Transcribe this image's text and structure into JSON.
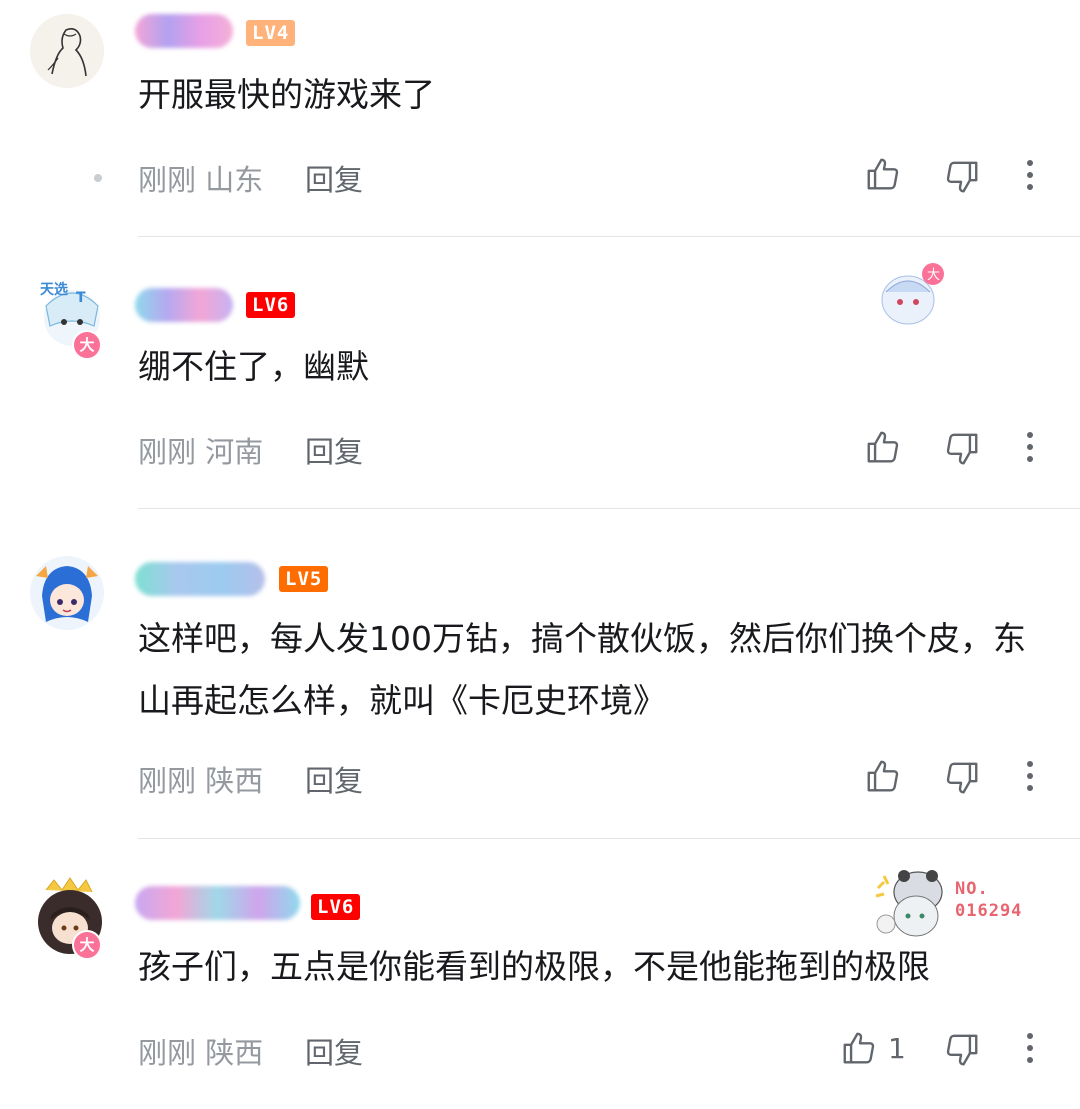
{
  "comments": [
    {
      "level": "LV4",
      "text": "开服最快的游戏来了",
      "time": "刚刚",
      "location": "山东",
      "reply_label": "回复",
      "likes": ""
    },
    {
      "level": "LV6",
      "text": "绷不住了，幽默",
      "time": "刚刚",
      "location": "河南",
      "reply_label": "回复",
      "likes": "",
      "avatar_badge": "大"
    },
    {
      "level": "LV5",
      "text": "这样吧，每人发100万钻，搞个散伙饭，然后你们换个皮，东山再起怎么样，就叫《卡厄史环境》",
      "time": "刚刚",
      "location": "陕西",
      "reply_label": "回复",
      "likes": ""
    },
    {
      "level": "LV6",
      "text": "孩子们，五点是你能看到的极限，不是他能拖到的极限",
      "time": "刚刚",
      "location": "陕西",
      "reply_label": "回复",
      "likes": "1",
      "avatar_badge": "大",
      "fan_badge": "NO.\n016294"
    }
  ],
  "colors": {
    "lv4": "#ffb27a",
    "lv5": "#ff6c00",
    "lv6": "#ff0000",
    "meta": "#9499a0",
    "badge_pink": "#fb7299"
  }
}
